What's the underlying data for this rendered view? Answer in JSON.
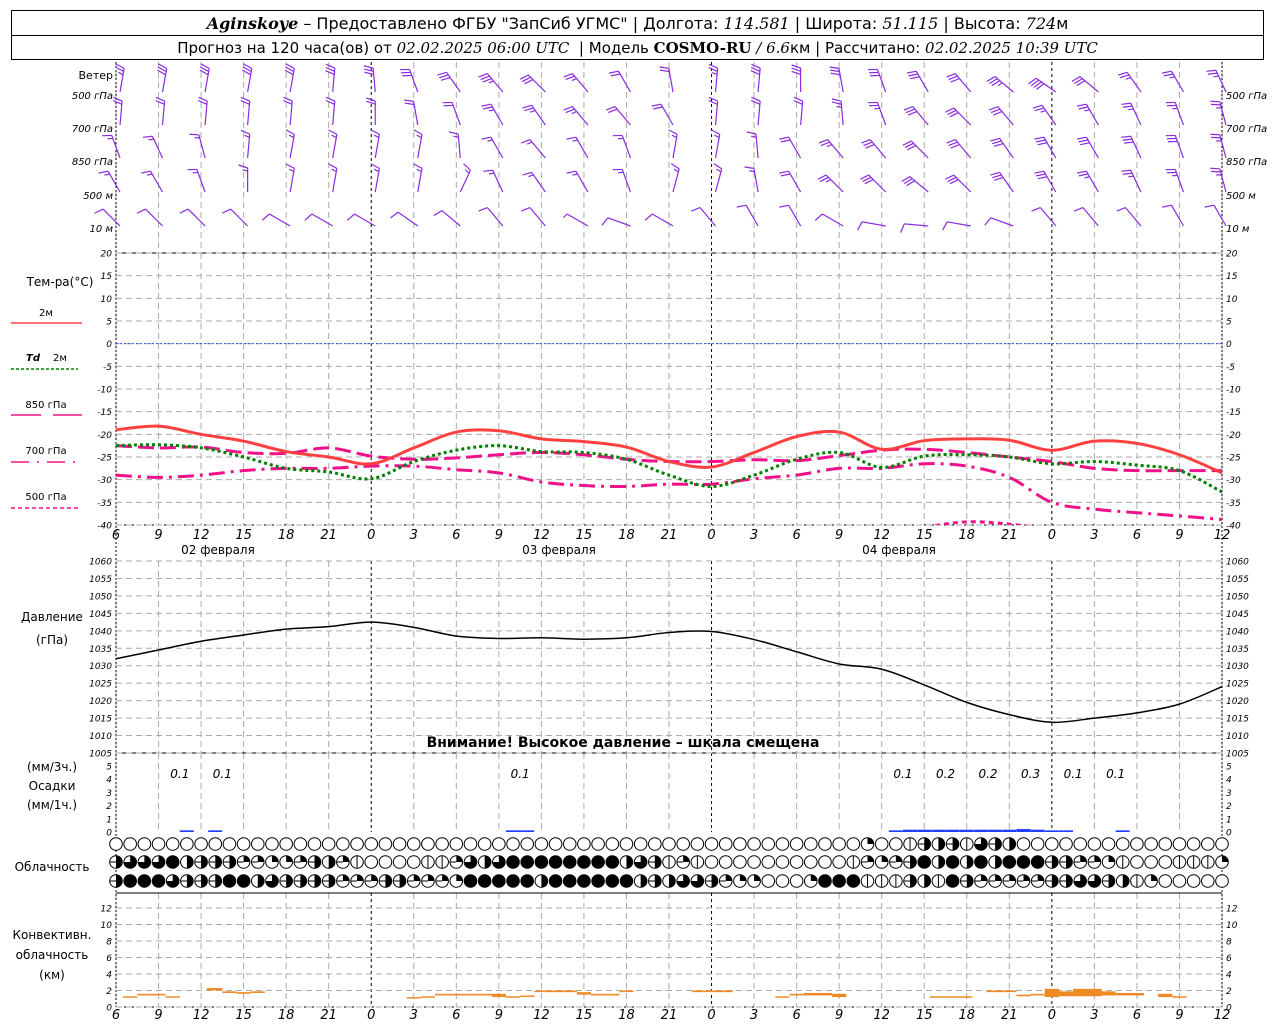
{
  "header": {
    "station": "Aginskoye",
    "provider": " – Предоставлено ФГБУ \"ЗапСиб УГМС\" | ",
    "lon_label": "Долгота: ",
    "lon": "114.581",
    "lat_label": " | Широта: ",
    "lat": "51.115",
    "alt_label": " | Высота: ",
    "alt": "724",
    "alt_unit": "м",
    "forecast_label": "Прогноз на 120 часа(ов) от ",
    "forecast_start": "02.02.2025 06:00 UTC",
    "model_label": "  | Модель ",
    "model": "COSMO-RU",
    "model_sep": " / ",
    "resolution": "6.6",
    "resolution_unit": "км",
    "calc_label": " | Рассчитано: ",
    "calc_time": "02.02.2025 10:39 UTC"
  },
  "labels": {
    "wind": "Ветер",
    "wind_levels": [
      "500 гПа",
      "700 гПа",
      "850 гПа",
      "500 м",
      "10 м"
    ],
    "temp_title": "Тем-ра(°C)",
    "t2m": "2м",
    "td_a": "Td",
    "td_b": "2м",
    "t850": "850 гПа",
    "t700": "700 гПа",
    "t500": "500 гПа",
    "pressure_a": "Давление",
    "pressure_b": "(гПа)",
    "precip_a": "(мм/3ч.)",
    "precip_b": "Осадки",
    "precip_c": "(мм/1ч.)",
    "clouds": "Облачность",
    "conv_a": "Конвективн.",
    "conv_b": "облачность",
    "conv_c": "(км)",
    "warning": "Внимание! Высокое давление – шкала смещена",
    "days": [
      "02 февраля",
      "03 февраля",
      "04 февраля"
    ]
  },
  "colors": {
    "t2m": "#ff4040",
    "td": "#008000",
    "levels": "#f0108a",
    "wind": "#8a2be2",
    "precip": "#2040ff",
    "conv": "#f08a24",
    "zero": "#3050ff"
  },
  "chart_data": {
    "type": "line",
    "title": "Meteogram Aginskoye",
    "x_unit": "hours from 02.02.2025 06:00 UTC",
    "x_ticks": [
      "6",
      "9",
      "12",
      "15",
      "18",
      "21",
      "0",
      "3",
      "6",
      "9",
      "12",
      "15",
      "18",
      "21",
      "0",
      "3",
      "6",
      "9",
      "12",
      "15",
      "18",
      "21",
      "0",
      "3",
      "6",
      "9",
      "12"
    ],
    "x_step_hours": 3,
    "day_breaks_hours": [
      18,
      42,
      66
    ],
    "hours": [
      0,
      3,
      6,
      9,
      12,
      15,
      18,
      21,
      24,
      27,
      30,
      33,
      36,
      39,
      42,
      45,
      48,
      51,
      54,
      57,
      60,
      63,
      66,
      69,
      72,
      75,
      78
    ],
    "wind": {
      "unit": "barbs (full=10, half=5)",
      "levels": [
        {
          "name": "500 гПа",
          "dir": [
            10,
            10,
            10,
            10,
            10,
            5,
            355,
            340,
            325,
            320,
            315,
            320,
            330,
            350,
            5,
            5,
            0,
            350,
            340,
            330,
            320,
            310,
            305,
            310,
            325,
            330,
            335
          ],
          "speed": [
            25,
            30,
            30,
            30,
            30,
            30,
            30,
            30,
            30,
            35,
            30,
            25,
            20,
            20,
            25,
            30,
            30,
            30,
            30,
            30,
            30,
            35,
            40,
            30,
            25,
            25,
            25
          ]
        },
        {
          "name": "700 гПа",
          "dir": [
            5,
            5,
            5,
            5,
            5,
            5,
            0,
            350,
            340,
            330,
            325,
            320,
            320,
            330,
            5,
            5,
            5,
            355,
            340,
            320,
            315,
            320,
            325,
            330,
            335,
            340,
            345
          ],
          "speed": [
            20,
            20,
            20,
            20,
            20,
            20,
            20,
            20,
            20,
            25,
            25,
            25,
            20,
            20,
            20,
            20,
            20,
            25,
            25,
            30,
            30,
            30,
            25,
            25,
            25,
            25,
            25
          ]
        },
        {
          "name": "850 гПа",
          "dir": [
            340,
            335,
            345,
            5,
            10,
            10,
            10,
            10,
            355,
            330,
            320,
            330,
            340,
            10,
            10,
            355,
            330,
            320,
            320,
            315,
            320,
            325,
            330,
            330,
            335,
            340,
            345
          ],
          "speed": [
            15,
            15,
            15,
            15,
            15,
            15,
            15,
            15,
            15,
            15,
            15,
            15,
            15,
            15,
            15,
            15,
            20,
            25,
            30,
            30,
            30,
            30,
            30,
            30,
            30,
            30,
            25
          ]
        },
        {
          "name": "500 м",
          "dir": [
            330,
            330,
            340,
            0,
            10,
            10,
            10,
            10,
            25,
            335,
            325,
            330,
            340,
            15,
            15,
            350,
            330,
            315,
            315,
            310,
            315,
            325,
            330,
            330,
            335,
            340,
            345
          ],
          "speed": [
            15,
            15,
            15,
            15,
            15,
            15,
            15,
            15,
            15,
            15,
            15,
            15,
            15,
            15,
            15,
            15,
            20,
            25,
            30,
            30,
            30,
            30,
            30,
            25,
            25,
            25,
            25
          ]
        },
        {
          "name": "10 м",
          "dir": [
            315,
            315,
            315,
            315,
            300,
            300,
            300,
            305,
            310,
            320,
            320,
            300,
            290,
            300,
            320,
            330,
            330,
            300,
            280,
            275,
            280,
            290,
            320,
            320,
            320,
            330,
            330
          ],
          "speed": [
            10,
            10,
            10,
            10,
            10,
            10,
            10,
            10,
            10,
            10,
            10,
            5,
            10,
            10,
            10,
            10,
            10,
            10,
            10,
            10,
            10,
            10,
            10,
            10,
            10,
            10,
            10
          ]
        }
      ]
    },
    "temperature": {
      "ylabel": "Тем-ра(°C)",
      "ylim": [
        -40,
        20
      ],
      "yticks": [
        20,
        15,
        10,
        5,
        0,
        -5,
        -10,
        -15,
        -20,
        -25,
        -30,
        -35,
        -40
      ],
      "series": [
        {
          "name": "2м",
          "values": [
            -19,
            -18.2,
            -20,
            -21.5,
            -23.8,
            -25,
            -26.5,
            -23,
            -19.5,
            -19.2,
            -21,
            -21.6,
            -22.8,
            -26,
            -27.2,
            -24,
            -20.5,
            -19.5,
            -23.3,
            -21.4,
            -21,
            -21.3,
            -23.5,
            -21.5,
            -22,
            -24.5,
            -28.5
          ]
        },
        {
          "name": "Td 2м",
          "values": [
            -22.5,
            -22.3,
            -23,
            -25,
            -27.5,
            -28.3,
            -29.8,
            -26,
            -23.5,
            -22.5,
            -23.8,
            -24,
            -25.5,
            -29,
            -31.5,
            -29,
            -25.5,
            -24,
            -27.3,
            -24.8,
            -24.5,
            -25,
            -26.5,
            -26,
            -26.8,
            -28,
            -32.7
          ]
        },
        {
          "name": "850 гПа",
          "values": [
            -22.5,
            -23,
            -22.8,
            -24,
            -24.2,
            -23,
            -24.8,
            -25.5,
            -25.2,
            -24.5,
            -24,
            -24.5,
            -25.5,
            -26,
            -26,
            -25.6,
            -25.8,
            -24.7,
            -23.5,
            -23.3,
            -24,
            -25,
            -26,
            -27.5,
            -28,
            -28,
            -28
          ]
        },
        {
          "name": "700 гПа",
          "values": [
            -29,
            -29.5,
            -29,
            -28,
            -27.5,
            -27.5,
            -27,
            -27,
            -27.8,
            -28.5,
            -30.5,
            -31.3,
            -31.5,
            -31,
            -31,
            -29.8,
            -29,
            -27.5,
            -27.5,
            -26.5,
            -27,
            -29.5,
            -35,
            -36.5,
            -37.3,
            -38,
            -38.8
          ]
        },
        {
          "name": "500 гПа",
          "values": [
            null,
            null,
            null,
            null,
            null,
            null,
            null,
            null,
            null,
            null,
            null,
            null,
            null,
            null,
            null,
            null,
            null,
            null,
            -42,
            -40.5,
            -39.3,
            -39.8,
            -41,
            null,
            null,
            null,
            null
          ]
        }
      ]
    },
    "pressure": {
      "ylabel": "Давление (гПа)",
      "ylim": [
        1005,
        1060
      ],
      "yticks": [
        1060,
        1055,
        1050,
        1045,
        1040,
        1035,
        1030,
        1025,
        1020,
        1015,
        1010,
        1005
      ],
      "values": [
        1032,
        1034.5,
        1037,
        1038.8,
        1040.5,
        1041.2,
        1042.5,
        1041,
        1038.5,
        1037.8,
        1038,
        1037.6,
        1038,
        1039.5,
        1039.8,
        1037.5,
        1034,
        1030.5,
        1029,
        1024.5,
        1019.5,
        1016,
        1013.8,
        1015,
        1016.5,
        1019,
        1024
      ]
    },
    "precipitation": {
      "ylim": [
        0,
        5
      ],
      "yticks": [
        5,
        4,
        3,
        2,
        1,
        0
      ],
      "three_hour": [
        {
          "hour_mid": 4.5,
          "label": "0.1"
        },
        {
          "hour_mid": 7.5,
          "label": "0.1"
        },
        {
          "hour_mid": 28.5,
          "label": "0.1"
        },
        {
          "hour_mid": 55.5,
          "label": "0.1"
        },
        {
          "hour_mid": 58.5,
          "label": "0.2"
        },
        {
          "hour_mid": 61.5,
          "label": "0.2"
        },
        {
          "hour_mid": 64.5,
          "label": "0.3"
        },
        {
          "hour_mid": 67.5,
          "label": "0.1"
        },
        {
          "hour_mid": 70.5,
          "label": "0.1"
        }
      ],
      "hourly": [
        [
          5,
          0.05
        ],
        [
          7,
          0.05
        ],
        [
          28,
          0.05
        ],
        [
          29,
          0.05
        ],
        [
          55,
          0.05
        ],
        [
          56,
          0.1
        ],
        [
          57,
          0.1
        ],
        [
          58,
          0.1
        ],
        [
          59,
          0.1
        ],
        [
          60,
          0.1
        ],
        [
          61,
          0.1
        ],
        [
          62,
          0.1
        ],
        [
          63,
          0.1
        ],
        [
          64,
          0.15
        ],
        [
          65,
          0.1
        ],
        [
          66,
          0.05
        ],
        [
          67,
          0.05
        ],
        [
          71,
          0.05
        ]
      ]
    },
    "cloud_octas": {
      "high": [
        0,
        0,
        0,
        0,
        0,
        0,
        0,
        0,
        0,
        0,
        0,
        0,
        0,
        0,
        0,
        0,
        0,
        0,
        0,
        0,
        0,
        0,
        0,
        0,
        0,
        0,
        0,
        0,
        0,
        0,
        0,
        0,
        0,
        0,
        0,
        0,
        0,
        0,
        0,
        0,
        0,
        0,
        0,
        0,
        0,
        0,
        0,
        0,
        0,
        0,
        0,
        0,
        0,
        2,
        0,
        0,
        1,
        5,
        4,
        5,
        1,
        6,
        5,
        4,
        0,
        0,
        0,
        0,
        0,
        0,
        0,
        0,
        0,
        0,
        0,
        0,
        0,
        0,
        0
      ],
      "middle": [
        5,
        6,
        6,
        6,
        8,
        4,
        5,
        5,
        5,
        3,
        3,
        2,
        2,
        3,
        5,
        4,
        3,
        1,
        0,
        0,
        0,
        0,
        1,
        1,
        3,
        6,
        4,
        6,
        8,
        8,
        8,
        8,
        8,
        8,
        8,
        8,
        4,
        6,
        5,
        1,
        3,
        1,
        0,
        0,
        0,
        0,
        0,
        0,
        0,
        0,
        0,
        0,
        1,
        3,
        2,
        3,
        5,
        8,
        4,
        8,
        4,
        8,
        4,
        8,
        8,
        8,
        5,
        5,
        3,
        3,
        2,
        1,
        0,
        0,
        0,
        1,
        1,
        1,
        2
      ],
      "low": [
        5,
        8,
        8,
        8,
        6,
        5,
        5,
        5,
        8,
        8,
        4,
        6,
        5,
        5,
        5,
        5,
        3,
        3,
        3,
        5,
        5,
        3,
        3,
        3,
        2,
        8,
        8,
        8,
        8,
        8,
        4,
        8,
        8,
        8,
        8,
        8,
        8,
        4,
        5,
        4,
        6,
        6,
        5,
        3,
        2,
        2,
        0,
        0,
        0,
        2,
        8,
        8,
        8,
        1,
        1,
        1,
        5,
        4,
        1,
        8,
        5,
        3,
        3,
        3,
        3,
        3,
        5,
        5,
        6,
        6,
        5,
        4,
        1,
        2,
        0,
        0,
        0,
        0,
        0
      ]
    },
    "convective": {
      "ylabel": "Конвективн. облачность (км)",
      "ylim": [
        0,
        13.5
      ],
      "yticks": [
        12,
        10,
        8,
        6,
        4,
        2,
        0
      ],
      "segments": [
        [
          0.5,
          1.5,
          1.2,
          1.3
        ],
        [
          1.5,
          3.5,
          1.4,
          1.6
        ],
        [
          3.5,
          4.5,
          1.2,
          1.3
        ],
        [
          6.4,
          7.5,
          2.0,
          2.3
        ],
        [
          7.5,
          8.5,
          1.7,
          1.9
        ],
        [
          8.5,
          9.5,
          1.6,
          1.8
        ],
        [
          9.5,
          10.5,
          1.7,
          1.9
        ],
        [
          20.5,
          21.5,
          1.1,
          1.2
        ],
        [
          21.5,
          22.5,
          1.2,
          1.3
        ],
        [
          22.5,
          26.5,
          1.4,
          1.6
        ],
        [
          26.5,
          27.5,
          1.2,
          1.6
        ],
        [
          27.5,
          28.5,
          1.2,
          1.3
        ],
        [
          28.5,
          29.5,
          1.3,
          1.4
        ],
        [
          29.5,
          32.5,
          1.8,
          2.0
        ],
        [
          32.5,
          33.5,
          1.5,
          1.8
        ],
        [
          33.5,
          35.5,
          1.4,
          1.6
        ],
        [
          35.5,
          36.5,
          1.8,
          2.0
        ],
        [
          40.6,
          43.5,
          1.8,
          2.0
        ],
        [
          46.5,
          47.5,
          1.2,
          1.3
        ],
        [
          47.5,
          48.5,
          1.4,
          1.6
        ],
        [
          48.5,
          50.5,
          1.4,
          1.7
        ],
        [
          50.5,
          51.5,
          1.2,
          1.6
        ],
        [
          57.4,
          60.4,
          1.2,
          1.3
        ],
        [
          61.4,
          63.5,
          1.8,
          2.0
        ],
        [
          63.5,
          64.5,
          1.3,
          1.5
        ],
        [
          64.5,
          65.5,
          1.4,
          1.6
        ],
        [
          65.5,
          66.5,
          1.2,
          2.2
        ],
        [
          66.5,
          67.5,
          1.3,
          1.9
        ],
        [
          67.5,
          69.5,
          1.3,
          2.2
        ],
        [
          69.5,
          70.5,
          1.4,
          1.9
        ],
        [
          70.5,
          72.5,
          1.4,
          1.7
        ],
        [
          73.5,
          74.5,
          1.2,
          1.6
        ],
        [
          74.5,
          75.5,
          1.2,
          1.3
        ]
      ]
    }
  }
}
